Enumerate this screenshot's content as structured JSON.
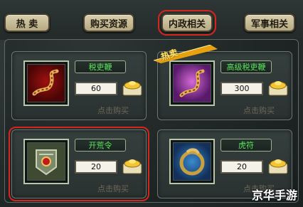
{
  "tabs": [
    {
      "label": "热 卖"
    },
    {
      "label": "购买资源"
    },
    {
      "label": "内政相关"
    },
    {
      "label": "军事相关"
    }
  ],
  "hot_badge": "热卖",
  "items": [
    {
      "name": "税吏鞭",
      "quantity": "60",
      "buy_label": "点击购买",
      "icon": "whip-icon"
    },
    {
      "name": "高级税吏鞭",
      "quantity": "300",
      "buy_label": "点击购买",
      "icon": "purple-whip-icon"
    },
    {
      "name": "开荒令",
      "quantity": "20",
      "buy_label": "点击购买",
      "icon": "token-icon"
    },
    {
      "name": "虎符",
      "quantity": "20",
      "buy_label": "点击购买",
      "icon": "tiger-tally-icon"
    }
  ],
  "watermark": "京华手游",
  "colors": {
    "highlight": "#d8241f",
    "item_name": "#57e85a"
  }
}
